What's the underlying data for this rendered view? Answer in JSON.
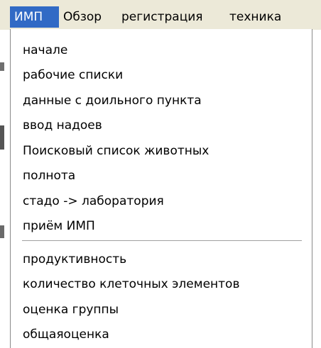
{
  "menubar": {
    "items": [
      {
        "label": "ИМП",
        "active": true
      },
      {
        "label": "Обзор",
        "active": false
      },
      {
        "label": "регистрация",
        "active": false
      },
      {
        "label": "техника",
        "active": false
      }
    ]
  },
  "dropdown": {
    "group1": [
      "начале",
      "рабочие списки",
      "данные с доильного пункта",
      "ввод надоев",
      "Поисковый список животных",
      "полнота",
      "стадо -> лаборатория",
      "приём ИМП"
    ],
    "group2": [
      "продуктивность",
      "количество клеточных элементов",
      "оценка группы",
      "общаяоценка"
    ]
  },
  "colors": {
    "menubar_bg": "#ece9d8",
    "highlight": "#316ac5"
  }
}
